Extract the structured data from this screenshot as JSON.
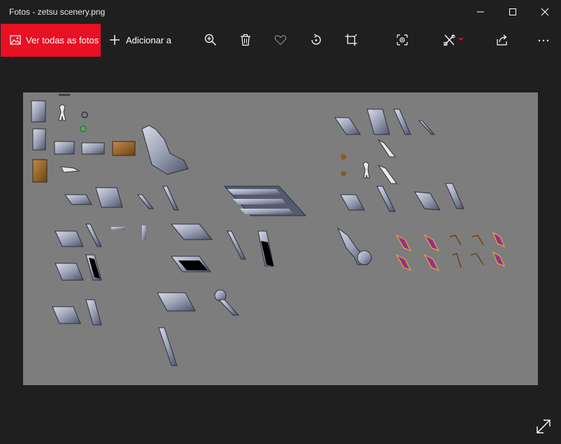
{
  "window": {
    "title": "Fotos - zetsu scenery.png"
  },
  "toolbar": {
    "view_all_label": "Ver todas as fotos",
    "add_to_label": "Adicionar a"
  },
  "colors": {
    "accent": "#e81123",
    "background": "#1f1f1f",
    "canvas": "#7d7d7d"
  }
}
